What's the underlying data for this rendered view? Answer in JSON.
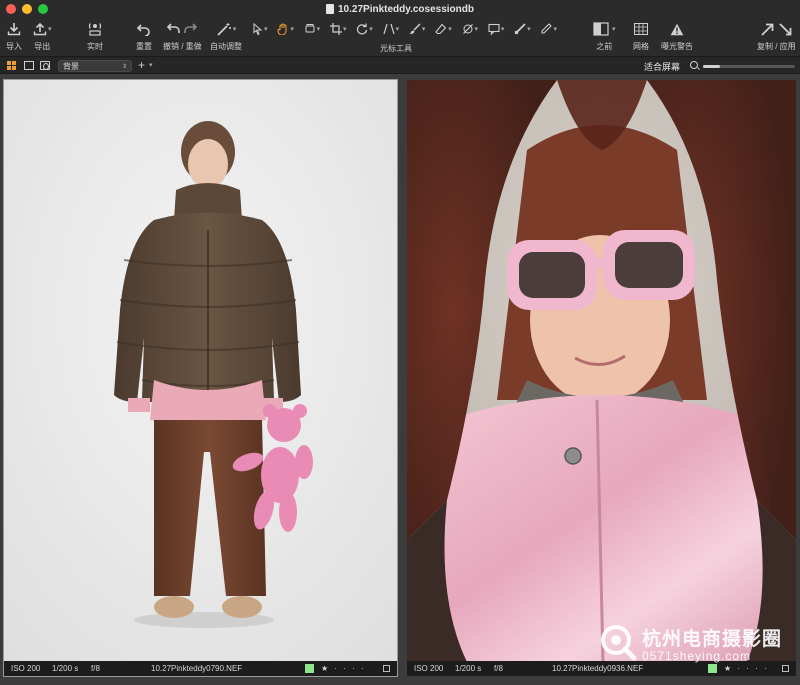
{
  "window": {
    "title": "10.27Pinkteddy.cosessiondb"
  },
  "toolbar": {
    "import_label": "导入",
    "export_label": "导出",
    "live_label": "实时",
    "reset_label": "重置",
    "undo_redo_label": "撤销 / 重做",
    "auto_adjust_label": "自动调整",
    "cursor_tools_label": "光标工具",
    "before_label": "之前",
    "grid_label": "网格",
    "exposure_warning_label": "曝光警告",
    "copy_apply_label": "复制 / 应用"
  },
  "subbar": {
    "layer_value": "背景",
    "fit_label": "适合屏幕",
    "zoom_level": 0.18
  },
  "photos": [
    {
      "iso": "ISO 200",
      "shutter": "1/200 s",
      "aperture": "f/8",
      "filename": "10.27Pinkteddy0790.NEF",
      "color_tag": "#8ee58e",
      "rating_text": "★ · · · ·",
      "selected": true
    },
    {
      "iso": "ISO 200",
      "shutter": "1/200 s",
      "aperture": "f/8",
      "filename": "10.27Pinkteddy0936.NEF",
      "color_tag": "#8ee58e",
      "rating_text": "★ · · · ·",
      "selected": false
    }
  ],
  "watermark": {
    "text_cn": "杭州电商摄影圈",
    "text_en": "0571sheying.com"
  }
}
